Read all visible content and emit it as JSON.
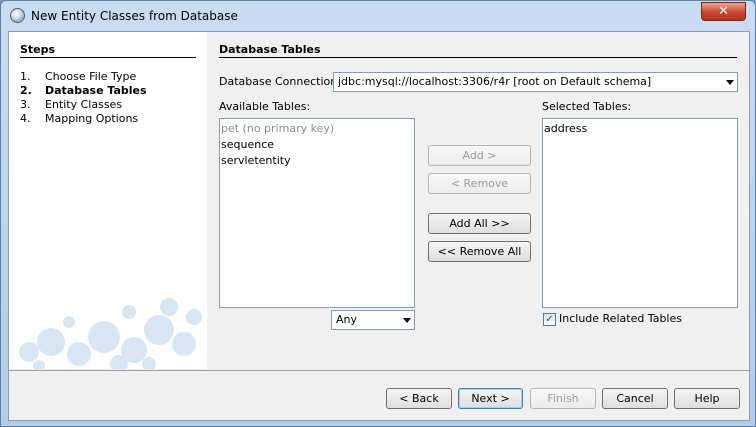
{
  "window": {
    "title": "New Entity Classes from Database",
    "close_glyph": "✕"
  },
  "steps": {
    "title": "Steps",
    "items": [
      {
        "num": "1.",
        "label": "Choose File Type"
      },
      {
        "num": "2.",
        "label": "Database Tables"
      },
      {
        "num": "3.",
        "label": "Entity Classes"
      },
      {
        "num": "4.",
        "label": "Mapping Options"
      }
    ]
  },
  "main": {
    "section_title": "Database Tables",
    "connection_label": "Database Connection:",
    "connection_value": "jdbc:mysql://localhost:3306/r4r [root on Default schema]",
    "available_label": "Available Tables:",
    "available_tables": [
      {
        "label": "pet (no primary key)"
      },
      {
        "label": "sequence"
      },
      {
        "label": "servletentity"
      }
    ],
    "selected_label": "Selected Tables:",
    "selected_tables": [
      {
        "label": "address"
      }
    ],
    "filter_value": "Any",
    "add_label": "Add >",
    "remove_label": "< Remove",
    "add_all_label": "Add All >>",
    "remove_all_label": "<< Remove All",
    "include_related_label": "Include Related Tables",
    "include_related_checked": true
  },
  "footer": {
    "back_label": "< Back",
    "next_label": "Next >",
    "finish_label": "Finish",
    "cancel_label": "Cancel",
    "help_label": "Help"
  }
}
